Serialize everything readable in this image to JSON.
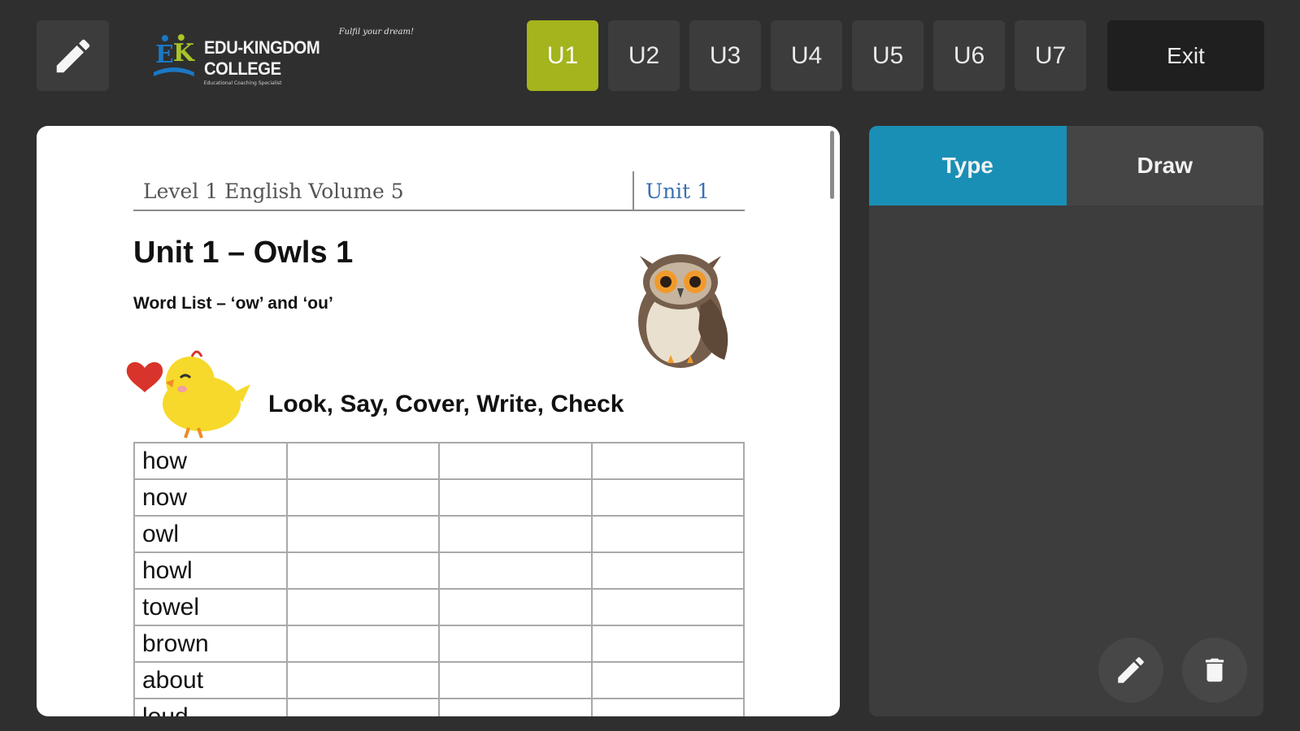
{
  "toolbar": {
    "pencil_icon": "pencil-icon",
    "logo": {
      "tagline": "Fulfil your dream!",
      "name": "EDU-KINGDOM COLLEGE",
      "sub": "Educational Coaching Specialist"
    },
    "units": [
      {
        "label": "U1",
        "active": true
      },
      {
        "label": "U2",
        "active": false
      },
      {
        "label": "U3",
        "active": false
      },
      {
        "label": "U4",
        "active": false
      },
      {
        "label": "U5",
        "active": false
      },
      {
        "label": "U6",
        "active": false
      },
      {
        "label": "U7",
        "active": false
      }
    ],
    "exit_label": "Exit",
    "active_color": "#a4b41c"
  },
  "document": {
    "header_left": "Level 1 English Volume 5",
    "header_right": "Unit 1",
    "title": "Unit 1 – Owls 1",
    "subtitle": "Word List – ‘ow’ and ‘ou’",
    "instruction": "Look, Say, Cover, Write, Check",
    "words": [
      "how",
      "now",
      "owl",
      "howl",
      "towel",
      "brown",
      "about",
      "loud"
    ]
  },
  "panel": {
    "tabs": [
      {
        "label": "Type",
        "active": true
      },
      {
        "label": "Draw",
        "active": false
      }
    ],
    "active_color": "#1a8fb5",
    "tools": [
      "pencil-icon",
      "trash-icon"
    ]
  }
}
